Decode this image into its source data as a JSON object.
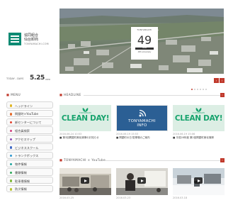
{
  "site": {
    "name_line1": "協同組合",
    "name_line2": "仙台卸商",
    "name_line3": "センター",
    "subtitle": "TONYAMACHI.COM"
  },
  "today": {
    "label": "TODAY - DAYS",
    "date": "5.25",
    "dow": "WED"
  },
  "hero": {
    "badge_top": "TONYAMACHI",
    "badge_number": "49",
    "badge_bar": "SENDAI",
    "badge_anniv": "49th anniversary",
    "slide_count": 6,
    "active_slide": 0,
    "prev_symbol": "‹",
    "next_symbol": "›"
  },
  "menu": {
    "heading": "MENU",
    "items": [
      {
        "label": "ヘッドライン",
        "color": "#e0b522"
      },
      {
        "label": "問屋町×YouTube",
        "color": "#e46b2b"
      },
      {
        "label": "卸センターについて",
        "color": "#e2422f"
      },
      {
        "label": "組合員検索",
        "color": "#d13f7e"
      },
      {
        "label": "アクセスマップ",
        "color": "#8b4fb4"
      },
      {
        "label": "ビジネススクール",
        "color": "#3d67c4"
      },
      {
        "label": "トランクボックス",
        "color": "#2e98cf"
      },
      {
        "label": "物件情報",
        "color": "#22a6a0"
      },
      {
        "label": "書類情報",
        "color": "#2fa95a"
      },
      {
        "label": "駐車場情報",
        "color": "#7fb83a"
      },
      {
        "label": "防災情報",
        "color": "#b7c233"
      }
    ]
  },
  "headline": {
    "heading": "HEADLINE",
    "more_symbol": "›",
    "cards": [
      {
        "type": "clean",
        "thumb_big": "CLEAN DAY!",
        "thumb_small": "TONYAMACHI",
        "date": "2016.06.24  10:53",
        "title": "■ 第3回問屋町美化清掃のお知らせ"
      },
      {
        "type": "info",
        "thumb_big": "TONYAMACHI",
        "thumb_small": "INFO",
        "date": "2016.06.19  15:53",
        "title": "■ 問屋町の日 駐車場のご案内"
      },
      {
        "type": "clean",
        "thumb_big": "CLEAN DAY!",
        "thumb_small": "TONYAMACHI",
        "date": "2016.06.19  15:06",
        "title": "■ 平成28年度 第2回問屋町美化清掃"
      }
    ]
  },
  "youtube": {
    "heading": "TONYAMACHI × YouTube",
    "more_symbol": "›",
    "videos": [
      {
        "date": "2016.03.25",
        "scene": "hall"
      },
      {
        "date": "2016.03.23",
        "scene": "speaker"
      },
      {
        "date": "2016.03.18",
        "scene": "snow"
      }
    ]
  }
}
